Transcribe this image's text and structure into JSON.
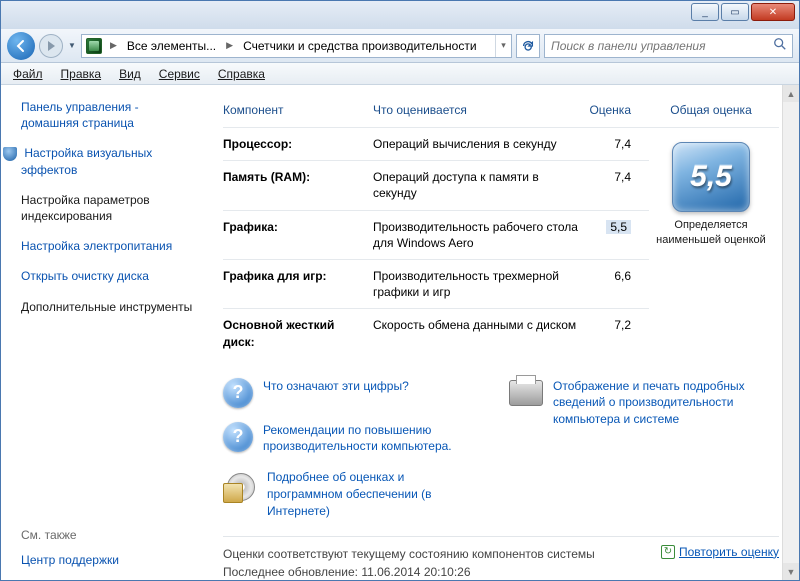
{
  "titlebar": {
    "min": "_",
    "max": "▭",
    "close": "✕"
  },
  "address": {
    "bc1": "Все элементы...",
    "bc2": "Счетчики и средства производительности",
    "search_placeholder": "Поиск в панели управления"
  },
  "menu": {
    "file": "Файл",
    "edit": "Правка",
    "view": "Вид",
    "tools": "Сервис",
    "help": "Справка"
  },
  "sidebar": {
    "home": "Панель управления - домашняя страница",
    "links": [
      "Настройка визуальных эффектов",
      "Настройка параметров индексирования",
      "Настройка электропитания",
      "Открыть очистку диска",
      "Дополнительные инструменты"
    ],
    "seealso_head": "См. также",
    "seealso": "Центр поддержки"
  },
  "table": {
    "head": {
      "component": "Компонент",
      "what": "Что оценивается",
      "score": "Оценка",
      "overall": "Общая оценка"
    },
    "rows": [
      {
        "label": "Процессор:",
        "what": "Операций вычисления в секунду",
        "score": "7,4"
      },
      {
        "label": "Память (RAM):",
        "what": "Операций доступа к памяти в секунду",
        "score": "7,4"
      },
      {
        "label": "Графика:",
        "what": "Производительность рабочего стола для Windows Aero",
        "score": "5,5",
        "hl": true
      },
      {
        "label": "Графика для игр:",
        "what": "Производительность трехмерной графики и игр",
        "score": "6,6"
      },
      {
        "label": "Основной жесткий диск:",
        "what": "Скорость обмена данными с диском",
        "score": "7,2"
      }
    ],
    "overall_value": "5,5",
    "overall_text": "Определяется наименьшей оценкой"
  },
  "help": {
    "q1": "Что означают эти цифры?",
    "q2": "Рекомендации по повышению производительности компьютера.",
    "print": "Отображение и печать подробных сведений о производительности компьютера и системе",
    "cd": "Подробнее об оценках и программном обеспечении (в Интернете)"
  },
  "footer": {
    "line1": "Оценки соответствуют текущему состоянию компонентов системы",
    "line2": "Последнее обновление: 11.06.2014 20:10:26",
    "repeat": "Повторить оценку"
  }
}
